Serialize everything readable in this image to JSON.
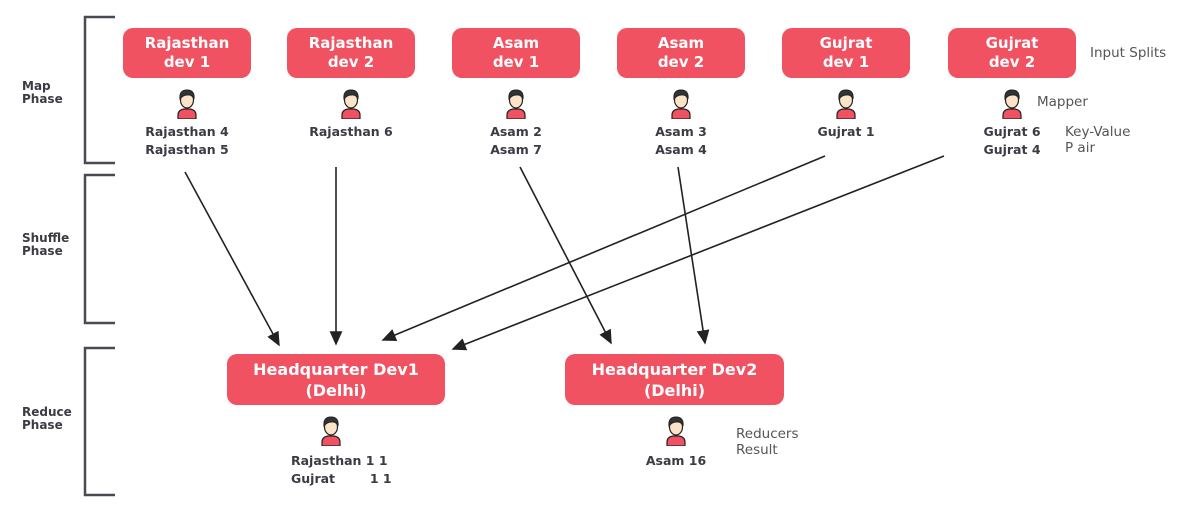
{
  "phases": {
    "map": "Map\nPhase",
    "shuffle": "Shuffle\nPhase",
    "reduce": "Reduce\nPhase"
  },
  "input_splits": [
    {
      "label": "Rajasthan\ndev 1",
      "output": "Rajasthan 4\nRajasthan 5"
    },
    {
      "label": "Rajasthan\ndev 2",
      "output": "Rajasthan 6"
    },
    {
      "label": "Asam\ndev 1",
      "output": "Asam 2\nAsam 7"
    },
    {
      "label": "Asam\ndev 2",
      "output": "Asam 3\nAsam 4"
    },
    {
      "label": "Gujrat\ndev 1",
      "output": "Gujrat  1"
    },
    {
      "label": "Gujrat\ndev 2",
      "output": "Gujrat 6\nGujrat 4"
    }
  ],
  "reducers": [
    {
      "label": "Headquarter Dev1\n(Delhi)",
      "result": "Rajasthan 1 1\nGujrat        1 1"
    },
    {
      "label": "Headquarter Dev2\n(Delhi)",
      "result": "Asam 16"
    }
  ],
  "notes": {
    "input_splits": "Input Splits",
    "mapper": "Mapper",
    "kv_pair": "Key-Value\n    P air",
    "reducers_result": "Reducers\nResult"
  },
  "colors": {
    "box": "#f05262",
    "text": "#3b3b45",
    "line": "#222222"
  },
  "icons": {
    "person": "person-icon"
  }
}
